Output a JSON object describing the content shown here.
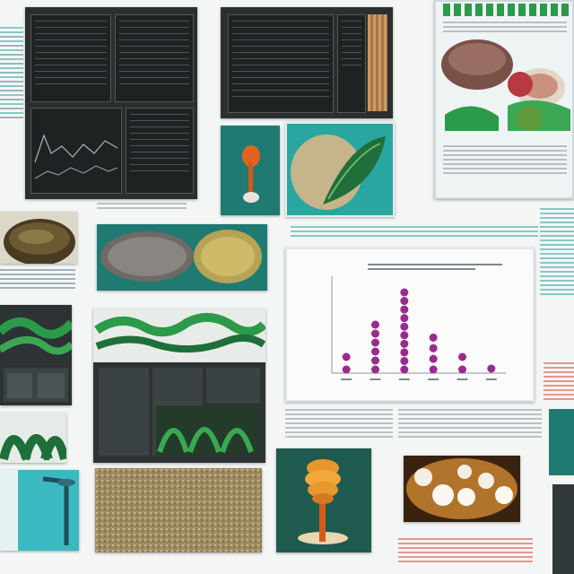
{
  "collage": {
    "description_free": true,
    "colors": {
      "background": "#f4f6f6",
      "dark_panel": "#2b2f30",
      "teal": "#2aa6a0",
      "green": "#2b9a49",
      "red": "#d8492d",
      "magenta": "#9b2a8f",
      "orange": "#e0641f",
      "honey": "#e8962e"
    },
    "chart_data": {
      "type": "scatter",
      "categories": [
        "",
        "",
        "",
        "",
        "",
        ""
      ],
      "values": [
        1,
        3,
        5,
        2.2,
        1,
        0.4
      ],
      "title": "",
      "xlabel": "",
      "ylabel": "",
      "ylim": [
        0,
        6
      ]
    }
  }
}
